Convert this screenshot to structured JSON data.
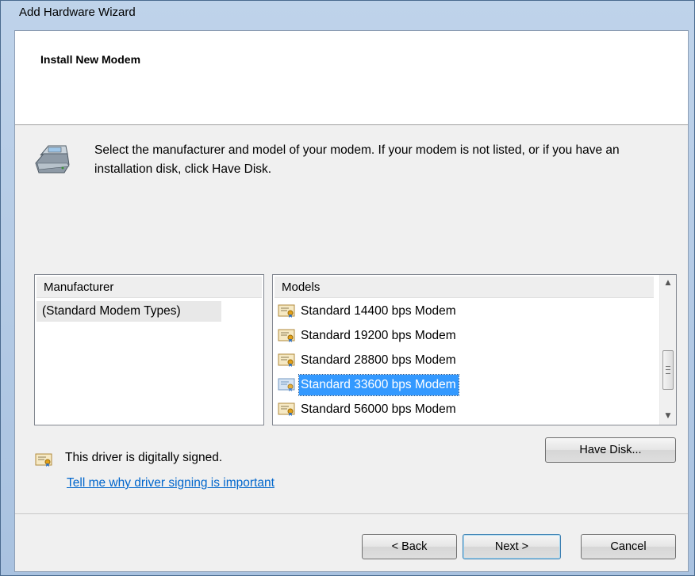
{
  "window": {
    "title": "Add Hardware Wizard"
  },
  "header": {
    "title": "Install New Modem"
  },
  "description": "Select the manufacturer and model of your modem. If your modem is not listed, or if you have an installation disk, click Have Disk.",
  "manufacturer_list": {
    "header": "Manufacturer",
    "items": [
      "(Standard Modem Types)"
    ],
    "selected": "(Standard Modem Types)"
  },
  "models_list": {
    "header": "Models",
    "items": [
      "Standard 14400 bps Modem",
      "Standard 19200 bps Modem",
      "Standard 28800 bps Modem",
      "Standard 33600 bps Modem",
      "Standard 56000 bps Modem"
    ],
    "selected": "Standard 33600 bps Modem"
  },
  "signing": {
    "status_text": "This driver is digitally signed.",
    "link_text": "Tell me why driver signing is important"
  },
  "buttons": {
    "have_disk": "Have Disk...",
    "back": "< Back",
    "next": "Next >",
    "cancel": "Cancel"
  },
  "icons": {
    "modem": "modem-icon",
    "certificate": "certificate-icon"
  },
  "colors": {
    "selection": "#3399ff",
    "link": "#0066cc"
  }
}
